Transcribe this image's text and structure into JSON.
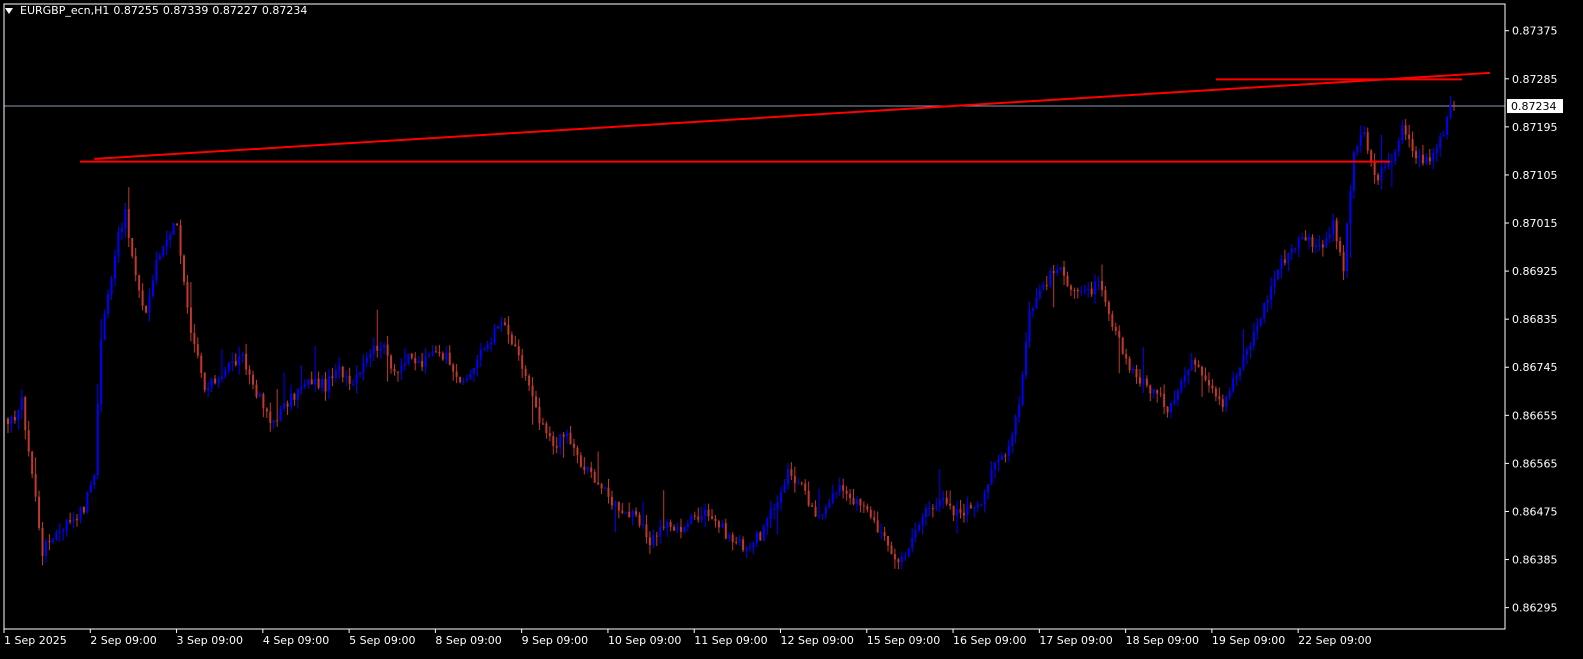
{
  "header": {
    "symbol_timeframe": "EURGBP_ecn,H1",
    "open": "0.87255",
    "high": "0.87339",
    "low": "0.87227",
    "close": "0.87234",
    "menu_icon": "triangle-down-icon"
  },
  "colors": {
    "background": "#000000",
    "axis": "#ffffff",
    "bull_candle": "#0000ff",
    "bear_candle": "#c0392b",
    "trendline": "#ff0000",
    "current_price_line": "#8a9bb0"
  },
  "current_price_label": "0.87234",
  "chart_data": {
    "type": "candlestick",
    "ylim": [
      0.86255,
      0.87425
    ],
    "price_ticks": [
      "0.87375",
      "0.87285",
      "0.87195",
      "0.87105",
      "0.87015",
      "0.86925",
      "0.86835",
      "0.86745",
      "0.86655",
      "0.86565",
      "0.86475",
      "0.86385",
      "0.86295"
    ],
    "time_ticks": [
      "1 Sep 2025",
      "2 Sep 09:00",
      "3 Sep 09:00",
      "4 Sep 09:00",
      "5 Sep 09:00",
      "8 Sep 09:00",
      "9 Sep 09:00",
      "10 Sep 09:00",
      "11 Sep 09:00",
      "12 Sep 09:00",
      "15 Sep 09:00",
      "16 Sep 09:00",
      "17 Sep 09:00",
      "18 Sep 09:00",
      "19 Sep 09:00",
      "22 Sep 09:00"
    ],
    "current_price": 0.87234,
    "anchors": [
      [
        0,
        0.8663
      ],
      [
        4,
        0.8668
      ],
      [
        8,
        0.865
      ],
      [
        10,
        0.864
      ],
      [
        13,
        0.8643
      ],
      [
        18,
        0.8646
      ],
      [
        22,
        0.8648
      ],
      [
        25,
        0.8655
      ],
      [
        27,
        0.868
      ],
      [
        29,
        0.8688
      ],
      [
        32,
        0.87
      ],
      [
        34,
        0.8703
      ],
      [
        36,
        0.8695
      ],
      [
        38,
        0.8688
      ],
      [
        40,
        0.8685
      ],
      [
        43,
        0.8694
      ],
      [
        46,
        0.8699
      ],
      [
        49,
        0.8702
      ],
      [
        51,
        0.869
      ],
      [
        53,
        0.868
      ],
      [
        55,
        0.8676
      ],
      [
        57,
        0.867
      ],
      [
        60,
        0.8672
      ],
      [
        64,
        0.8675
      ],
      [
        68,
        0.8676
      ],
      [
        72,
        0.867
      ],
      [
        76,
        0.8664
      ],
      [
        80,
        0.8667
      ],
      [
        84,
        0.867
      ],
      [
        88,
        0.8672
      ],
      [
        92,
        0.8671
      ],
      [
        96,
        0.8674
      ],
      [
        100,
        0.8672
      ],
      [
        104,
        0.8677
      ],
      [
        108,
        0.8679
      ],
      [
        112,
        0.8674
      ],
      [
        116,
        0.8676
      ],
      [
        120,
        0.8675
      ],
      [
        124,
        0.8678
      ],
      [
        128,
        0.8676
      ],
      [
        132,
        0.8671
      ],
      [
        136,
        0.8676
      ],
      [
        140,
        0.868
      ],
      [
        143,
        0.8683
      ],
      [
        146,
        0.8679
      ],
      [
        150,
        0.8673
      ],
      [
        154,
        0.8664
      ],
      [
        158,
        0.866
      ],
      [
        162,
        0.8662
      ],
      [
        166,
        0.8656
      ],
      [
        170,
        0.8654
      ],
      [
        174,
        0.865
      ],
      [
        178,
        0.8648
      ],
      [
        182,
        0.8646
      ],
      [
        186,
        0.8642
      ],
      [
        190,
        0.8645
      ],
      [
        194,
        0.8644
      ],
      [
        198,
        0.8646
      ],
      [
        202,
        0.8648
      ],
      [
        206,
        0.8645
      ],
      [
        210,
        0.8642
      ],
      [
        214,
        0.8641
      ],
      [
        218,
        0.8643
      ],
      [
        222,
        0.8648
      ],
      [
        226,
        0.8655
      ],
      [
        230,
        0.8652
      ],
      [
        234,
        0.8646
      ],
      [
        238,
        0.865
      ],
      [
        242,
        0.8652
      ],
      [
        246,
        0.8649
      ],
      [
        250,
        0.8647
      ],
      [
        254,
        0.8642
      ],
      [
        258,
        0.8638
      ],
      [
        262,
        0.8642
      ],
      [
        266,
        0.8648
      ],
      [
        270,
        0.865
      ],
      [
        274,
        0.8647
      ],
      [
        278,
        0.8648
      ],
      [
        282,
        0.865
      ],
      [
        286,
        0.8656
      ],
      [
        290,
        0.866
      ],
      [
        293,
        0.8668
      ],
      [
        296,
        0.8685
      ],
      [
        300,
        0.869
      ],
      [
        304,
        0.8693
      ],
      [
        308,
        0.869
      ],
      [
        312,
        0.8688
      ],
      [
        316,
        0.869
      ],
      [
        320,
        0.8682
      ],
      [
        324,
        0.8676
      ],
      [
        328,
        0.8672
      ],
      [
        332,
        0.867
      ],
      [
        336,
        0.8667
      ],
      [
        340,
        0.8672
      ],
      [
        344,
        0.8676
      ],
      [
        348,
        0.8672
      ],
      [
        352,
        0.8668
      ],
      [
        356,
        0.8673
      ],
      [
        360,
        0.8679
      ],
      [
        364,
        0.8686
      ],
      [
        368,
        0.8693
      ],
      [
        372,
        0.8697
      ],
      [
        376,
        0.8699
      ],
      [
        380,
        0.8697
      ],
      [
        384,
        0.8701
      ],
      [
        387,
        0.8693
      ],
      [
        390,
        0.8715
      ],
      [
        393,
        0.8718
      ],
      [
        396,
        0.871
      ],
      [
        400,
        0.8712
      ],
      [
        404,
        0.8719
      ],
      [
        408,
        0.8714
      ],
      [
        412,
        0.8713
      ],
      [
        416,
        0.8719
      ],
      [
        418,
        0.8724
      ],
      [
        419,
        0.87234
      ]
    ],
    "trendlines": [
      {
        "from": [
          "2 Sep 09:00",
          0.87135
        ],
        "to": [
          "22 Sep 09:00",
          0.87296
        ]
      },
      {
        "from": [
          "1 Sep 2025",
          0.8713
        ],
        "to": [
          "19 Sep 09:00",
          0.8713
        ]
      },
      {
        "from": [
          "19 Sep 09:00",
          0.87284
        ],
        "to": [
          "22 Sep 09:00",
          0.87284
        ]
      }
    ]
  }
}
